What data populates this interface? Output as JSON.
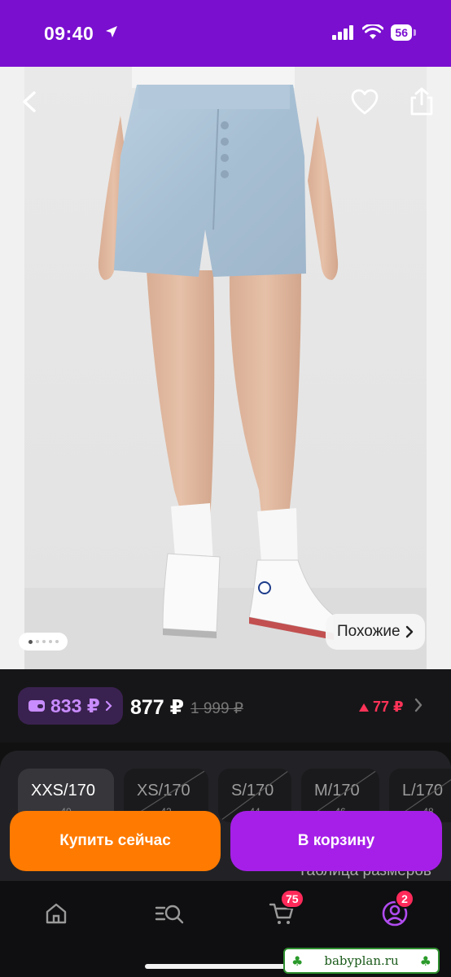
{
  "status_bar": {
    "time": "09:40",
    "battery": "56",
    "background": "#7a0fd0"
  },
  "product_image": {
    "slide_count": 5,
    "active_slide": 1,
    "similar_label": "Похожие"
  },
  "price": {
    "wallet_amount": "833 ₽",
    "current": "877 ₽",
    "old": "1 999 ₽",
    "delta": "77 ₽"
  },
  "sizes": [
    {
      "label": "XXS/170",
      "sub": "40",
      "selected": true,
      "unavailable": false
    },
    {
      "label": "XS/170",
      "sub": "42",
      "selected": false,
      "unavailable": true
    },
    {
      "label": "S/170",
      "sub": "44",
      "selected": false,
      "unavailable": true
    },
    {
      "label": "M/170",
      "sub": "46",
      "selected": false,
      "unavailable": true
    },
    {
      "label": "L/170",
      "sub": "48",
      "selected": false,
      "unavailable": true
    }
  ],
  "size_table_label": "Таблица размеров",
  "actions": {
    "buy_now": "Купить сейчас",
    "add_to_cart": "В корзину"
  },
  "tabbar": {
    "cart_badge": "75",
    "profile_badge": "2"
  },
  "watermark": "babyplan.ru",
  "colors": {
    "accent_purple": "#a61fe8",
    "buy_orange": "#ff7a00",
    "badge_red": "#ff2a5a",
    "wallet_text": "#c98cff"
  }
}
